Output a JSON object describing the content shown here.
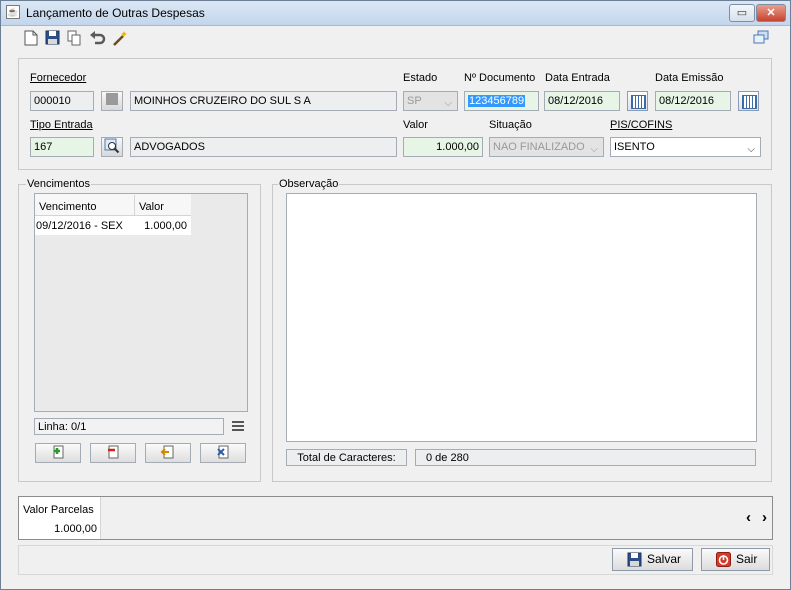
{
  "window": {
    "title": "Lançamento de Outras Despesas",
    "max_glyph": "▭",
    "close_glyph": "✕",
    "app_icon_glyph": "☕"
  },
  "toolbar": {
    "icons": [
      "new-document-icon",
      "save-icon",
      "copy-icon",
      "undo-icon",
      "magic-wand-icon",
      "windows-icon"
    ]
  },
  "header": {
    "fornecedor_label": "Fornecedor",
    "fornecedor_code": "000010",
    "fornecedor_name": "MOINHOS CRUZEIRO DO SUL S A",
    "estado_label": "Estado",
    "estado_value": "SP",
    "documento_label": "Nº Documento",
    "documento_value": "123456789",
    "data_entrada_label": "Data Entrada",
    "data_entrada_value": "08/12/2016",
    "data_emissao_label": "Data Emissão",
    "data_emissao_value": "08/12/2016",
    "tipo_entrada_label": "Tipo Entrada",
    "tipo_entrada_code": "167",
    "tipo_entrada_name": "ADVOGADOS",
    "valor_label": "Valor",
    "valor_value": "1.000,00",
    "situacao_label": "Situação",
    "situacao_value": "NAO FINALIZADO",
    "pis_cofins_label": "PIS/COFINS",
    "pis_cofins_value": "ISENTO"
  },
  "vencimentos": {
    "title": "Vencimentos",
    "columns": [
      "Vencimento",
      "Valor"
    ],
    "rows": [
      {
        "vencimento": "09/12/2016 - SEX",
        "valor": "1.000,00"
      }
    ],
    "linha_text": "Linha: 0/1"
  },
  "observacao": {
    "title": "Observação",
    "total_label": "Total de Caracteres:",
    "total_value": "0 de 280"
  },
  "parcelas": {
    "label": "Valor Parcelas",
    "value": "1.000,00",
    "nav_prev": "‹",
    "nav_next": "›"
  },
  "actions": {
    "salvar_label": "Salvar",
    "sair_label": "Sair"
  },
  "colors": {
    "field_green": "#e6f5e6",
    "selection": "#3399ff",
    "close_red": "#c7432e"
  }
}
